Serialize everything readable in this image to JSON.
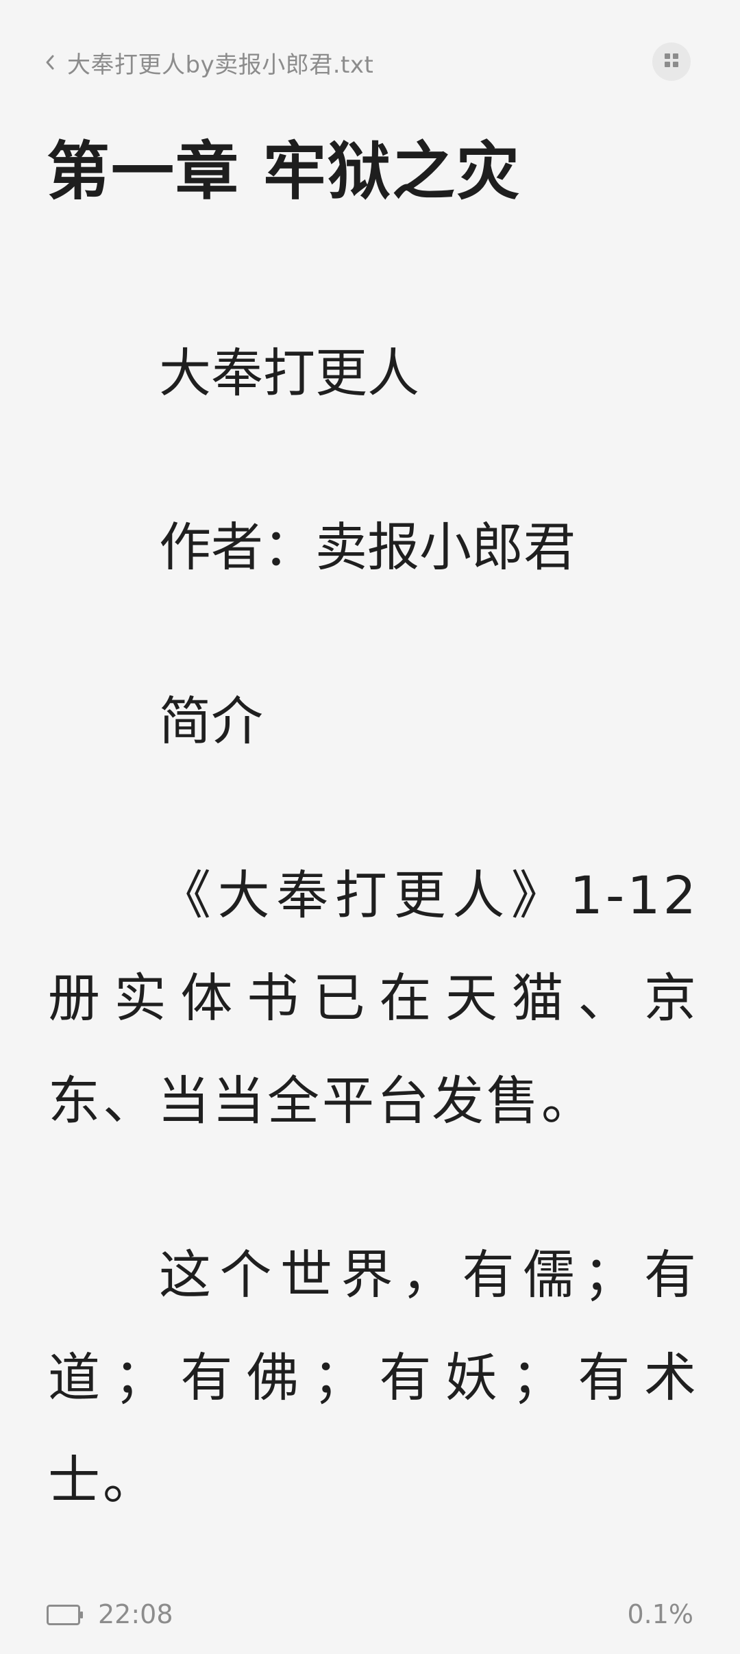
{
  "header": {
    "file_title": "大奉打更人by卖报小郎君.txt",
    "back_icon": "chevron-left-icon",
    "menu_icon": "grid-icon"
  },
  "chapter": {
    "title": "第一章  牢狱之灾"
  },
  "paragraphs": [
    "大奉打更人",
    "作者：卖报小郎君",
    "简介",
    "《大奉打更人》1-12 册实体书已在天猫、京东、当当全平台发售。",
    "这个世界，有儒；有道；有佛；有妖；有术士。"
  ],
  "status": {
    "time": "22:08",
    "progress": "0.1%",
    "battery_icon": "battery-icon"
  },
  "colors": {
    "background": "#f5f5f5",
    "text": "#1f1f1f",
    "muted": "#8c8c8c"
  }
}
